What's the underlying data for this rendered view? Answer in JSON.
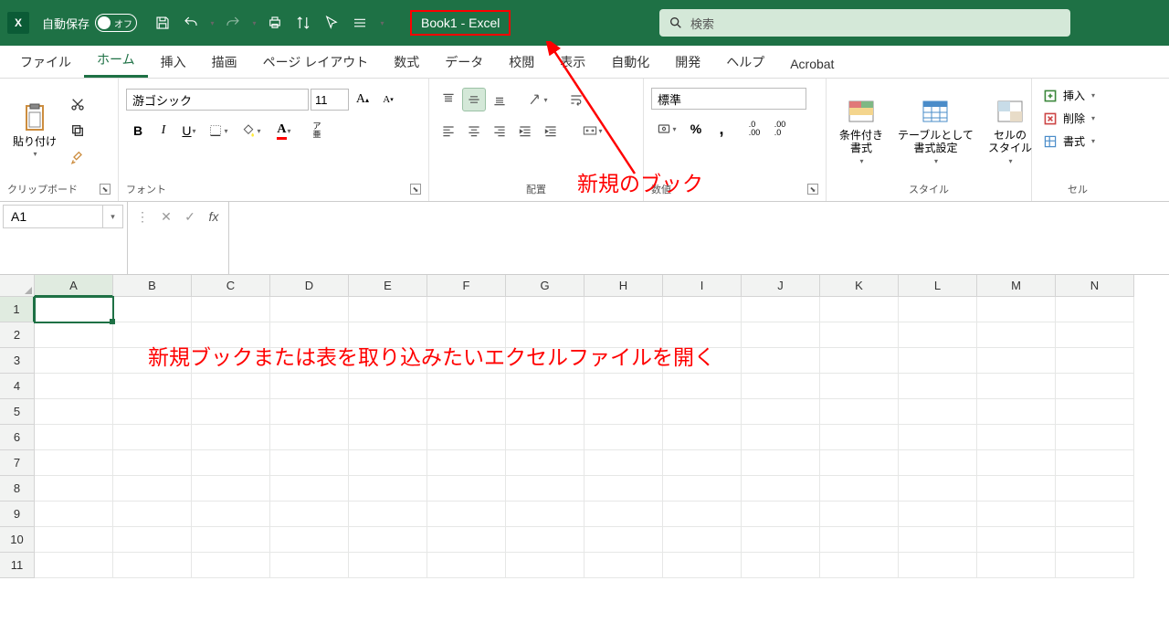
{
  "titleBar": {
    "autosave_label": "自動保存",
    "autosave_state": "オフ",
    "doc_title": "Book1  -  Excel",
    "search_placeholder": "検索"
  },
  "tabs": {
    "items": [
      "ファイル",
      "ホーム",
      "挿入",
      "描画",
      "ページ レイアウト",
      "数式",
      "データ",
      "校閲",
      "表示",
      "自動化",
      "開発",
      "ヘルプ",
      "Acrobat"
    ],
    "active_index": 1
  },
  "ribbon": {
    "clipboard": {
      "paste_label": "貼り付け",
      "group_label": "クリップボード"
    },
    "font": {
      "name": "游ゴシック",
      "size": "11",
      "ruby_label": "ア\n亜",
      "group_label": "フォント"
    },
    "alignment": {
      "group_label": "配置"
    },
    "number": {
      "format": "標準",
      "group_label": "数値"
    },
    "styles": {
      "cond_fmt": "条件付き\n書式",
      "table_fmt": "テーブルとして\n書式設定",
      "cell_style": "セルの\nスタイル",
      "group_label": "スタイル"
    },
    "cells": {
      "insert": "挿入",
      "delete": "削除",
      "format": "書式",
      "group_label": "セル"
    }
  },
  "formulaBar": {
    "name_box": "A1",
    "formula": ""
  },
  "grid": {
    "columns": [
      "A",
      "B",
      "C",
      "D",
      "E",
      "F",
      "G",
      "H",
      "I",
      "J",
      "K",
      "L",
      "M",
      "N"
    ],
    "row_count": 11,
    "active_cell": "A1"
  },
  "annotations": {
    "callout1": "新規のブック",
    "callout2": "新規ブックまたは表を取り込みたいエクセルファイルを開く"
  }
}
